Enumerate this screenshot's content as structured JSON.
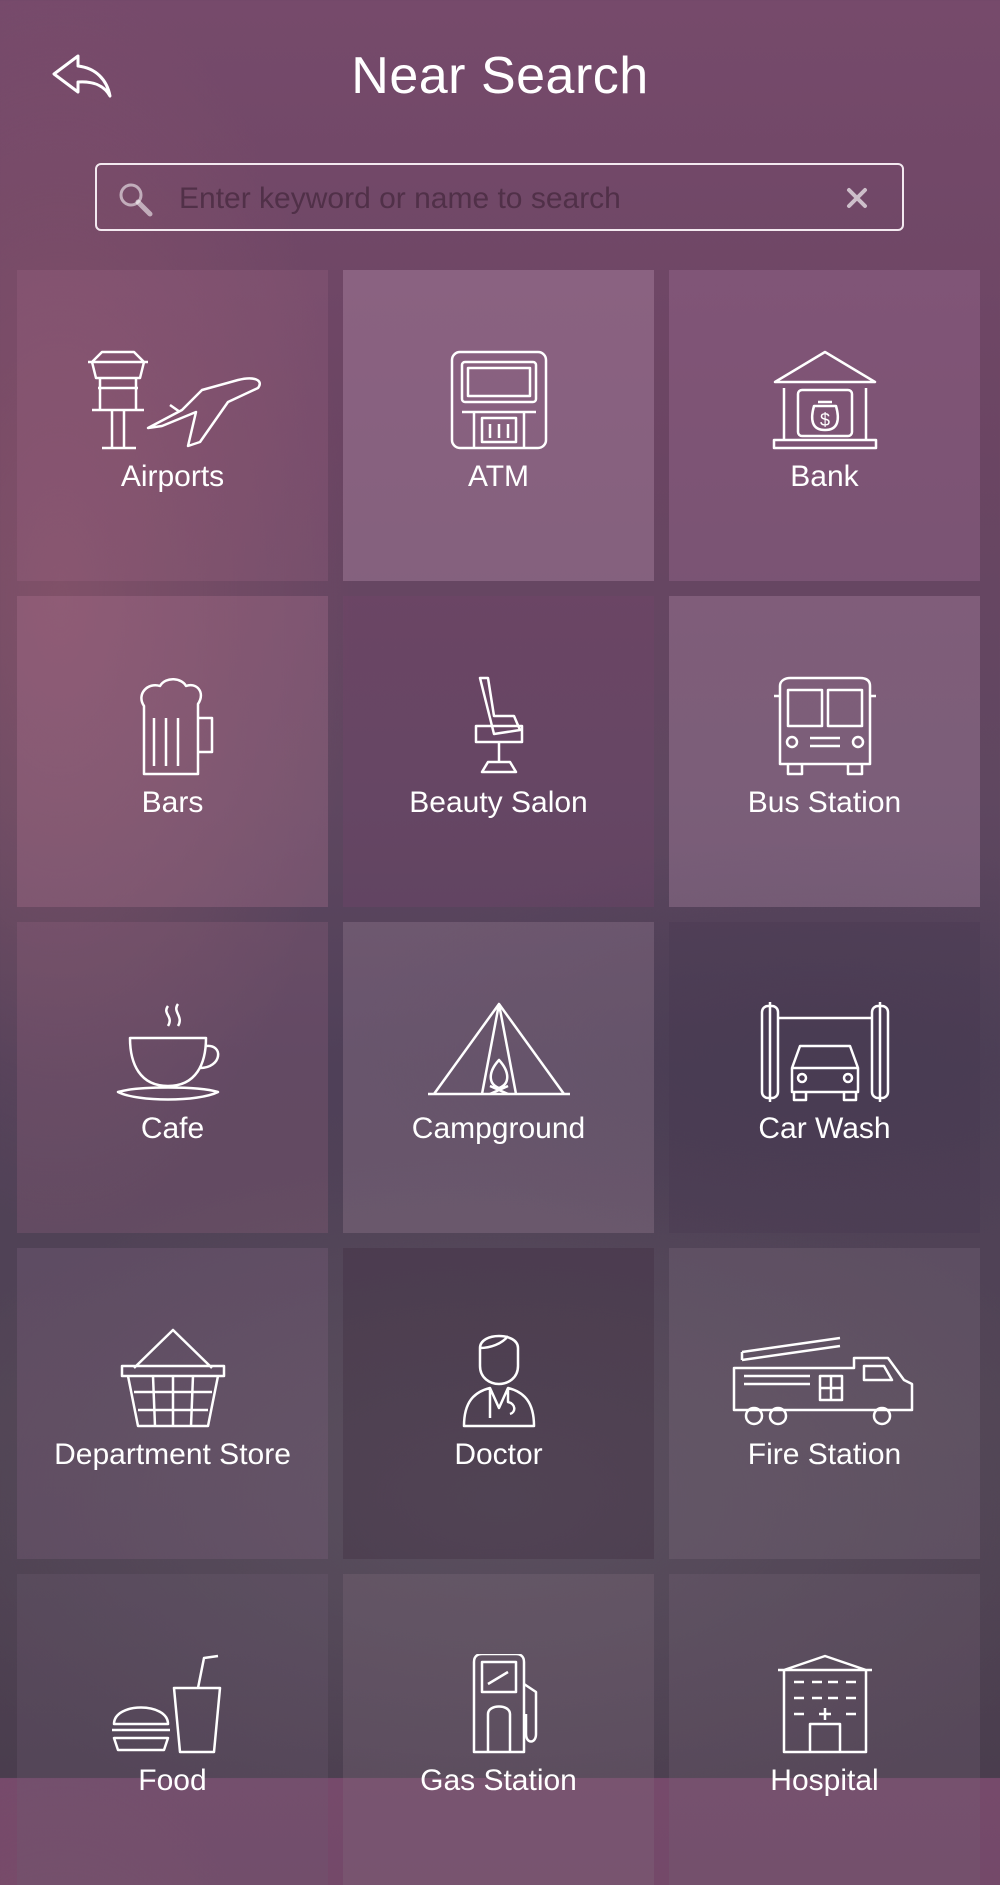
{
  "header": {
    "title": "Near Search",
    "back_icon": "back-arrow-icon"
  },
  "search": {
    "value": "",
    "placeholder": "Enter keyword or name to search",
    "search_icon": "magnifier-icon",
    "clear_icon": "close-icon"
  },
  "colors": {
    "tile_light": "#b08aa5",
    "tile_dark": "#3f2b3c",
    "text": "#ffffff"
  },
  "categories": [
    {
      "label": "Airports",
      "icon": "airport-icon"
    },
    {
      "label": "ATM",
      "icon": "atm-icon"
    },
    {
      "label": "Bank",
      "icon": "bank-icon"
    },
    {
      "label": "Bars",
      "icon": "beer-mug-icon"
    },
    {
      "label": "Beauty Salon",
      "icon": "salon-chair-icon"
    },
    {
      "label": "Bus Station",
      "icon": "bus-icon"
    },
    {
      "label": "Cafe",
      "icon": "coffee-cup-icon"
    },
    {
      "label": "Campground",
      "icon": "tent-icon"
    },
    {
      "label": "Car Wash",
      "icon": "car-wash-icon"
    },
    {
      "label": "Department Store",
      "icon": "basket-icon"
    },
    {
      "label": "Doctor",
      "icon": "doctor-icon"
    },
    {
      "label": "Fire Station",
      "icon": "fire-truck-icon"
    },
    {
      "label": "Food",
      "icon": "food-icon"
    },
    {
      "label": "Gas Station",
      "icon": "gas-pump-icon"
    },
    {
      "label": "Hospital",
      "icon": "hospital-icon"
    }
  ]
}
